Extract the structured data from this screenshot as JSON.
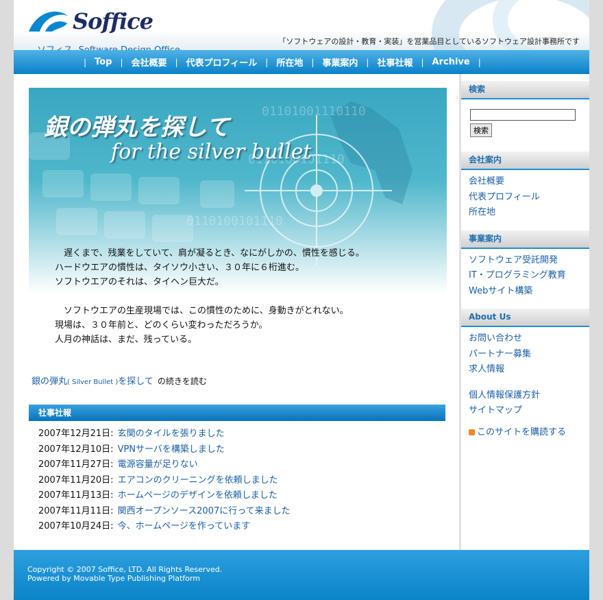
{
  "header": {
    "logo_name": "Soffice",
    "logo_sub": "ソフィス -Software Design Office-",
    "tagline": "「ソフトウェアの設計・教育・実装」を営業品目としているソフトウェア設計事務所です"
  },
  "nav": {
    "items": [
      "Top",
      "会社概要",
      "代表プロフィール",
      "所在地",
      "事業案内",
      "社事社報",
      "Archive"
    ],
    "separator": "|"
  },
  "hero": {
    "title": "銀の弾丸を探して",
    "subtitle": "for the silver bullet",
    "para1": "　遅くまで、残業をしていて、肩が凝るとき、なにがしかの、慣性を感じる。\nハードウエアの慣性は、タイソウ小さい、３０年に６桁進む。\nソフトウエアのそれは、タイヘン巨大だ。",
    "para2": "　ソフトウエアの生産現場では、この慣性のために、身動きがとれない。\n現場は、３０年前と、どのくらい変わっただろうか。\n人月の神話は、まだ、残っている。"
  },
  "readmore": {
    "link_a": "銀の弾丸",
    "link_small": "( Silver Bullet )",
    "link_b": "を探して",
    "rest": "の続きを読む"
  },
  "news": {
    "title": "社事社報",
    "items": [
      {
        "date": "2007年12月21日:",
        "title": "玄関のタイルを張りました"
      },
      {
        "date": "2007年12月10日:",
        "title": "VPNサーバを構築しました"
      },
      {
        "date": "2007年11月27日:",
        "title": "電源容量が足りない"
      },
      {
        "date": "2007年11月20日:",
        "title": "エアコンのクリーニングを依頼しました"
      },
      {
        "date": "2007年11月13日:",
        "title": "ホームページのデザインを依頼しました"
      },
      {
        "date": "2007年11月11日:",
        "title": "関西オープンソース2007に行って来ました"
      },
      {
        "date": "2007年10月24日:",
        "title": "今、ホームページを作っています"
      }
    ]
  },
  "sidebar": {
    "search_title": "検索",
    "search_button": "検索",
    "company_title": "会社案内",
    "company_links": [
      "会社概要",
      "代表プロフィール",
      "所在地"
    ],
    "business_title": "事業案内",
    "business_links": [
      "ソフトウェア受託開発",
      "IT・プログラミング教育",
      "Webサイト構築"
    ],
    "about_title": "About Us",
    "about_links": [
      "お問い合わせ",
      "パートナー募集",
      "求人情報"
    ],
    "about_links2": [
      "個人情報保護方針",
      "サイトマップ"
    ],
    "rss_label": "このサイトを購読する"
  },
  "footer": {
    "copyright": "Copyright © 2007 Soffice, LTD. All Rights Reserved.",
    "powered_prefix": "Powered by ",
    "powered_link": "Movable Type Publishing Platform"
  },
  "colors": {
    "nav": "#0a80c8",
    "accent": "#1f8fd6",
    "link": "#1a5fa8"
  }
}
